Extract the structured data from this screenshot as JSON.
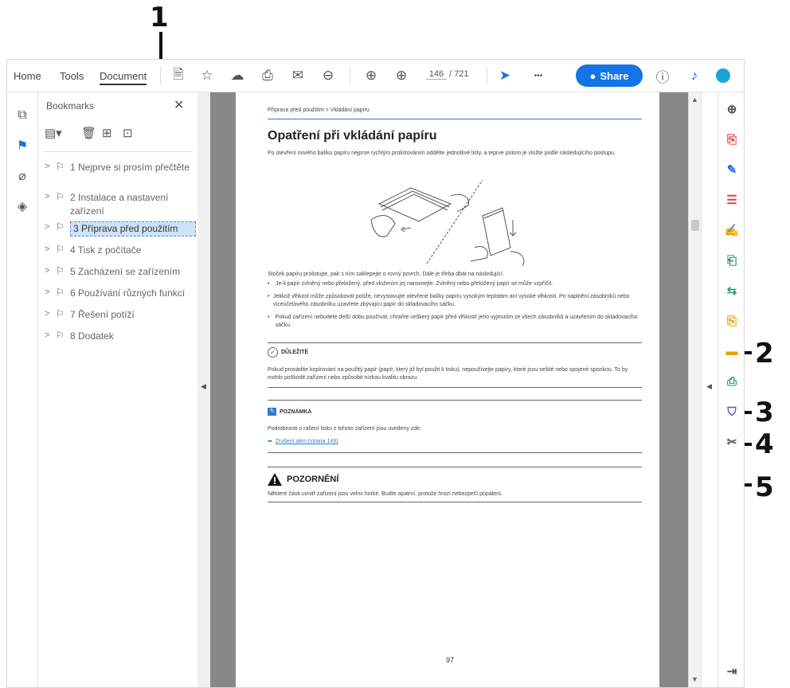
{
  "callouts": [
    "1",
    "2",
    "3",
    "4",
    "5"
  ],
  "menu": {
    "home": "Home",
    "tools": "Tools",
    "document": "Document"
  },
  "toolbar": {
    "page_current": "146",
    "page_sep": "/",
    "page_total": "721",
    "more": "•••",
    "share_label": "Share"
  },
  "bookmarks_panel": {
    "title": "Bookmarks",
    "close": "✕",
    "items": [
      {
        "label": "1 Nejprve si prosím přečtěte"
      },
      {
        "label": "2 Instalace a nastavení zařízení"
      },
      {
        "label": "3 Příprava před použitím"
      },
      {
        "label": "4 Tisk z počítače"
      },
      {
        "label": "5 Zacházení se zařízením"
      },
      {
        "label": "6 Používání různých funkcí"
      },
      {
        "label": "7 Řešení potíží"
      },
      {
        "label": "8 Dodatek"
      }
    ]
  },
  "page": {
    "breadcrumb": "Příprava před použitím > Vkládání papíru",
    "title": "Opatření při vkládání papíru",
    "intro": "Po otevření nového balíku papíru nejprve rychlým prolistováním oddělte jednotlivé listy, a teprve potom je vložte podle následujícího postupu.",
    "stack_text": "Stoček papíru prolistujte, pak s ním zaklepejte o rovný povrch. Dále je třeba dbát na následující.",
    "bullets": [
      "Je-li papír zvlněný nebo přeložený, před vložením jej narovnejte. Zvlněný nebo přeložený papír se může vzpříčit.",
      "Jelikož vlhkost může způsobovat potíže, nevystavujte otevřené balíky papíru vysokým teplotám ani vysoké vlhkosti. Po naplnění zásobníků nebo víceúčelového zásobníku uzavřete zbývající papír do skladovacího sáčku.",
      "Pokud zařízení nebudete delší dobu používat, chraňte veškerý papír před vlhkostí jeho vyjmutím ze všech zásobníků a uzavřením do skladovacího sáčku."
    ],
    "important_label": "DŮLEŽITÉ",
    "important_text": "Pokud provádíte kopírování na použitý papír (papír, který již byl použit k tisku), nepoužívejte papíry, které jsou sešité nebo spojené sponkou. To by mohlo poškodit zařízení nebo způsobit nízkou kvalitu obrazu.",
    "note_label": "POZNÁMKA",
    "note_text": "Podrobnosti o rašení tisku z tohoto zařízení jsou uvedeny zde:",
    "note_link": "Zrušení akm (strana 149)",
    "caution_label": "POZORNĚNÍ",
    "caution_text": "Některé části uvnitř zařízení jsou velmi horké. Budte opatrní, protože hrozí nebezpečí popálení.",
    "page_number": "97"
  },
  "colors": {
    "accent": "#1473e6",
    "rule": "#2e7bcf",
    "selection": "#cfe3f7"
  }
}
